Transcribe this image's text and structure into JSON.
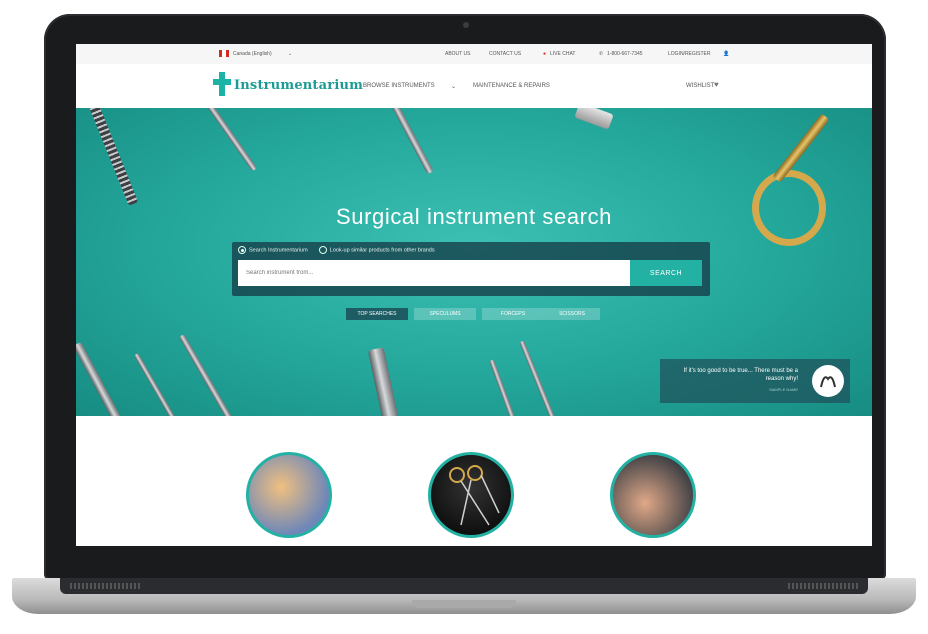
{
  "utility": {
    "region": "Canada (English)",
    "about": "ABOUT US",
    "contact": "CONTACT US",
    "live_chat": "LIVE CHAT",
    "phone": "1-800-667-7345",
    "login": "LOGIN/REGISTER"
  },
  "nav": {
    "logo": "Instrumentarium",
    "browse": "BROWSE INSTRUMENTS",
    "maintenance": "MAINTENANCE & REPAIRS",
    "wishlist": "WISHLIST"
  },
  "hero": {
    "title": "Surgical instrument search",
    "radio_1": "Search Instrumentarium",
    "radio_2": "Look-up similar products from other brands",
    "search_placeholder": "Search instrument from...",
    "search_button": "SEARCH",
    "tags": [
      "TOP SEARCHES",
      "SPECULUMS",
      "FORCEPS",
      "SCISSORS"
    ],
    "testimonial": "If it's too good to be true... There must be a reason why!",
    "testimonial_author": "SAMPLE NAME"
  },
  "colors": {
    "accent": "#23b1a4",
    "hero_bg": "#24a79b",
    "gold": "#d4a84b"
  },
  "icons": {
    "flag": "canada-flag-icon",
    "phone": "phone-icon",
    "user": "user-icon",
    "heart": "heart-icon",
    "chevron": "chevron-down-icon"
  }
}
